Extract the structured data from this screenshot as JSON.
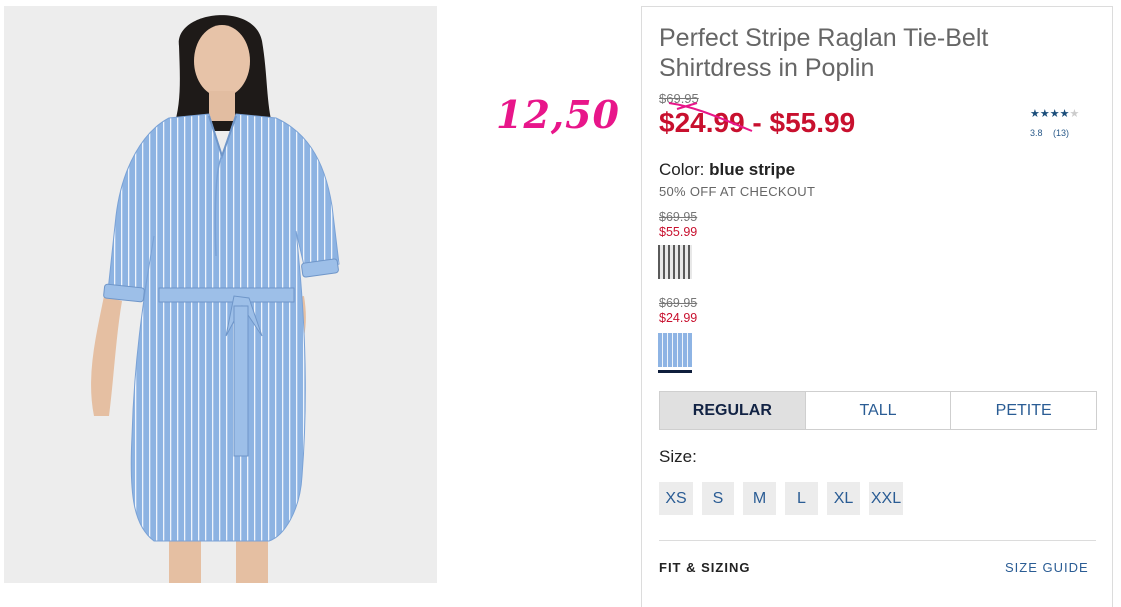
{
  "handwritten_price": "12,50",
  "product": {
    "title": "Perfect Stripe Raglan Tie-Belt Shirtdress in Poplin",
    "original_price": "$69.95",
    "sale_price_range": "$24.99 - $55.99",
    "rating": {
      "stars": 4,
      "max": 5,
      "score": "3.8",
      "count": "(13)"
    },
    "color_label": "Color:",
    "color_value": "blue stripe",
    "promo": "50% OFF AT CHECKOUT"
  },
  "swatches": [
    {
      "name": "gray stripe",
      "original": "$69.95",
      "sale": "$55.99",
      "selected": false
    },
    {
      "name": "blue stripe",
      "original": "$69.95",
      "sale": "$24.99",
      "selected": true
    }
  ],
  "fit_tabs": [
    {
      "label": "REGULAR",
      "active": true
    },
    {
      "label": "TALL",
      "active": false
    },
    {
      "label": "PETITE",
      "active": false
    }
  ],
  "size_label": "Size:",
  "sizes": [
    "XS",
    "S",
    "M",
    "L",
    "XL",
    "XXL"
  ],
  "fit_sizing_label": "FIT & SIZING",
  "size_guide_label": "SIZE GUIDE",
  "colors": {
    "sale_red": "#c8102e",
    "link_blue": "#2a5c94",
    "handwriting_pink": "#e8168a",
    "dress_blue": "#8eb4e4"
  }
}
